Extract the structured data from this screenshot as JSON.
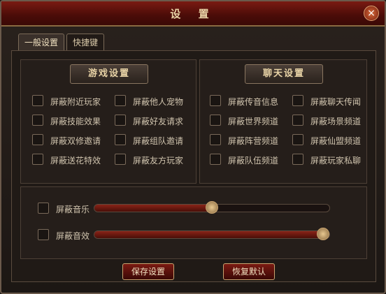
{
  "window": {
    "title": "设 置",
    "close_glyph": "×"
  },
  "tabs": [
    {
      "label": "一般设置"
    },
    {
      "label": "快捷键"
    }
  ],
  "game_settings": {
    "title": "游戏设置",
    "options": [
      "屏蔽附近玩家",
      "屏蔽他人宠物",
      "屏蔽技能效果",
      "屏蔽好友请求",
      "屏蔽双修邀请",
      "屏蔽组队邀请",
      "屏蔽送花特效",
      "屏蔽友方玩家"
    ]
  },
  "chat_settings": {
    "title": "聊天设置",
    "options": [
      "屏蔽传音信息",
      "屏蔽聊天传闻",
      "屏蔽世界频道",
      "屏蔽场景频道",
      "屏蔽阵营频道",
      "屏蔽仙盟频道",
      "屏蔽队伍频道",
      "屏蔽玩家私聊"
    ]
  },
  "audio": {
    "music": {
      "label": "屏蔽音乐",
      "volume_fraction": 0.5
    },
    "sfx": {
      "label": "屏蔽音效",
      "volume_fraction": 0.98
    }
  },
  "buttons": {
    "save": "保存设置",
    "reset": "恢复默认"
  },
  "colors": {
    "accent_red": "#7a1a12",
    "gold_text": "#e8d3a6"
  }
}
